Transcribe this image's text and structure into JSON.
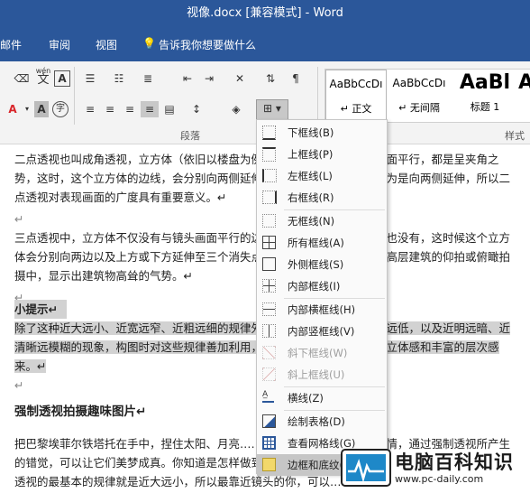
{
  "window": {
    "title": "视像.docx [兼容模式]  -  Word"
  },
  "menubar": {
    "tabs": [
      "邮件",
      "审阅",
      "视图"
    ],
    "tell_me": "告诉我你想要做什么"
  },
  "ribbon": {
    "paragraph_group_label": "段落",
    "styles_group_label": "样式",
    "styles": [
      {
        "preview": "AaBbCcDı",
        "name": "↵ 正文"
      },
      {
        "preview": "AaBbCcDı",
        "name": "↵ 无间隔"
      },
      {
        "preview": "AaBl",
        "name": "标题 1"
      },
      {
        "preview": "A",
        "name": ""
      }
    ],
    "wen_label": "wén",
    "wen_char": "文"
  },
  "document": {
    "p1": "二点透视也叫成角透视，立方体（依旧以楼盘为例）只有垂直的边与镜头画面平行，都是呈夹角之势，这时，这个立方体的边线，会分别向两侧延伸消失于两个消失点上。因为是向两侧延伸，所以二点透视对表现画面的广度具有重要意义。↵",
    "empty1": "↵",
    "p2": "三点透视中，立方体不仅没有与镜头画面平行的边，甚至连与画面垂直的面也没有，这时候这个立方体会分别向两边以及上方或下方延伸至三个消失点。三点透视经常被用在超高层建筑的仰拍或俯瞰拍摄中，显示出建筑物高耸的气势。↵",
    "empty2": "↵",
    "tip_title": "小提示↵",
    "tip_body": "除了这种近大远小、近宽远窄、近粗远细的规律外，还有近清远模糊、近高远低，以及近明远暗、近清晰远模糊的现象，构图时对这些规律善加利用，会使你拍出来的照片有着立体感和丰富的层次感来。↵",
    "empty3": "↵",
    "heading": "强制透视拍摄趣味图片↵",
    "p3": "把巴黎埃菲尔铁塔托在手中，捏住太阳、月亮……这些原本不可能办到的事情，通过强制透视所产生的错觉，可以让它们美梦成真。你知道是怎样做到的吗？",
    "p4": "透视的最基本的规律就是近大远小，所以最靠近镜头的你，可以……"
  },
  "border_menu": {
    "items": [
      {
        "label": "下框线(B)",
        "icon": "bottom-border-icon"
      },
      {
        "label": "上框线(P)",
        "icon": "top-border-icon"
      },
      {
        "label": "左框线(L)",
        "icon": "left-border-icon"
      },
      {
        "label": "右框线(R)",
        "icon": "right-border-icon"
      },
      {
        "label": "无框线(N)",
        "icon": "no-border-icon"
      },
      {
        "label": "所有框线(A)",
        "icon": "all-borders-icon"
      },
      {
        "label": "外侧框线(S)",
        "icon": "outside-borders-icon"
      },
      {
        "label": "内部框线(I)",
        "icon": "inside-borders-icon"
      },
      {
        "label": "内部横框线(H)",
        "icon": "inside-horizontal-border-icon"
      },
      {
        "label": "内部竖框线(V)",
        "icon": "inside-vertical-border-icon"
      },
      {
        "label": "斜下框线(W)",
        "icon": "diagonal-down-border-icon"
      },
      {
        "label": "斜上框线(U)",
        "icon": "diagonal-up-border-icon"
      },
      {
        "label": "横线(Z)",
        "icon": "horizontal-line-icon"
      },
      {
        "label": "绘制表格(D)",
        "icon": "draw-table-icon"
      },
      {
        "label": "查看网格线(G)",
        "icon": "view-gridlines-icon"
      },
      {
        "label": "边框和底纹(O)...",
        "icon": "borders-shading-icon"
      }
    ]
  },
  "watermark": {
    "cn": "电脑百科知识",
    "url": "www.pc-daily.com"
  },
  "colors": {
    "accent": "#2b579a",
    "font_color_red": "#d9252a",
    "highlight_grey": "#d2d2d2"
  }
}
